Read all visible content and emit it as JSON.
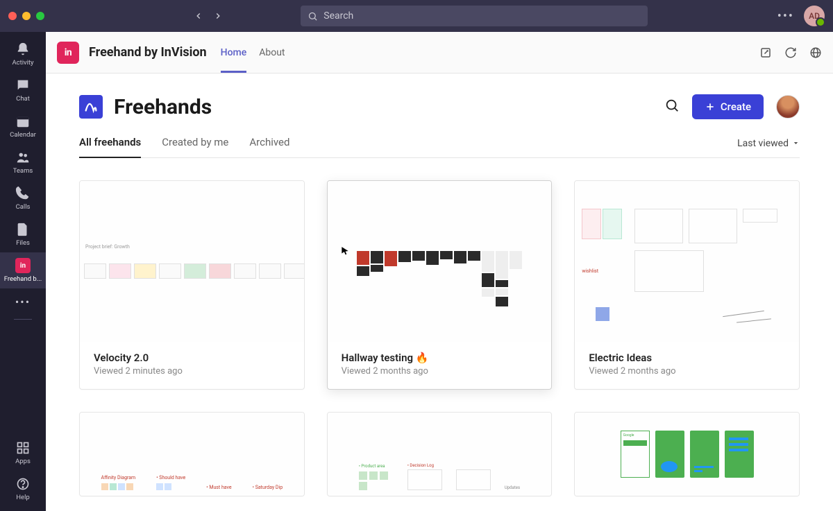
{
  "titlebar": {
    "search_placeholder": "Search",
    "avatar_initials": "AD"
  },
  "rail": {
    "items": [
      {
        "id": "activity",
        "label": "Activity"
      },
      {
        "id": "chat",
        "label": "Chat"
      },
      {
        "id": "calendar",
        "label": "Calendar"
      },
      {
        "id": "teams",
        "label": "Teams"
      },
      {
        "id": "calls",
        "label": "Calls"
      },
      {
        "id": "files",
        "label": "Files"
      },
      {
        "id": "freehand",
        "label": "Freehand b..."
      }
    ],
    "bottom": [
      {
        "id": "apps",
        "label": "Apps"
      },
      {
        "id": "help",
        "label": "Help"
      }
    ]
  },
  "appheader": {
    "logo_text": "in",
    "title": "Freehand by InVision",
    "tabs": [
      {
        "id": "home",
        "label": "Home",
        "active": true
      },
      {
        "id": "about",
        "label": "About",
        "active": false
      }
    ]
  },
  "page": {
    "title": "Freehands",
    "create_label": "Create",
    "filter_tabs": [
      {
        "id": "all",
        "label": "All freehands",
        "active": true
      },
      {
        "id": "mine",
        "label": "Created by me",
        "active": false
      },
      {
        "id": "archived",
        "label": "Archived",
        "active": false
      }
    ],
    "sort_label": "Last viewed"
  },
  "cards": [
    {
      "title": "Velocity 2.0",
      "sub": "Viewed 2 minutes ago"
    },
    {
      "title": "Hallway testing 🔥",
      "sub": "Viewed 2 months ago",
      "hovered": true
    },
    {
      "title": "Electric Ideas",
      "sub": "Viewed 2 months ago"
    },
    {
      "title": "",
      "sub": ""
    },
    {
      "title": "",
      "sub": ""
    },
    {
      "title": "",
      "sub": ""
    }
  ]
}
